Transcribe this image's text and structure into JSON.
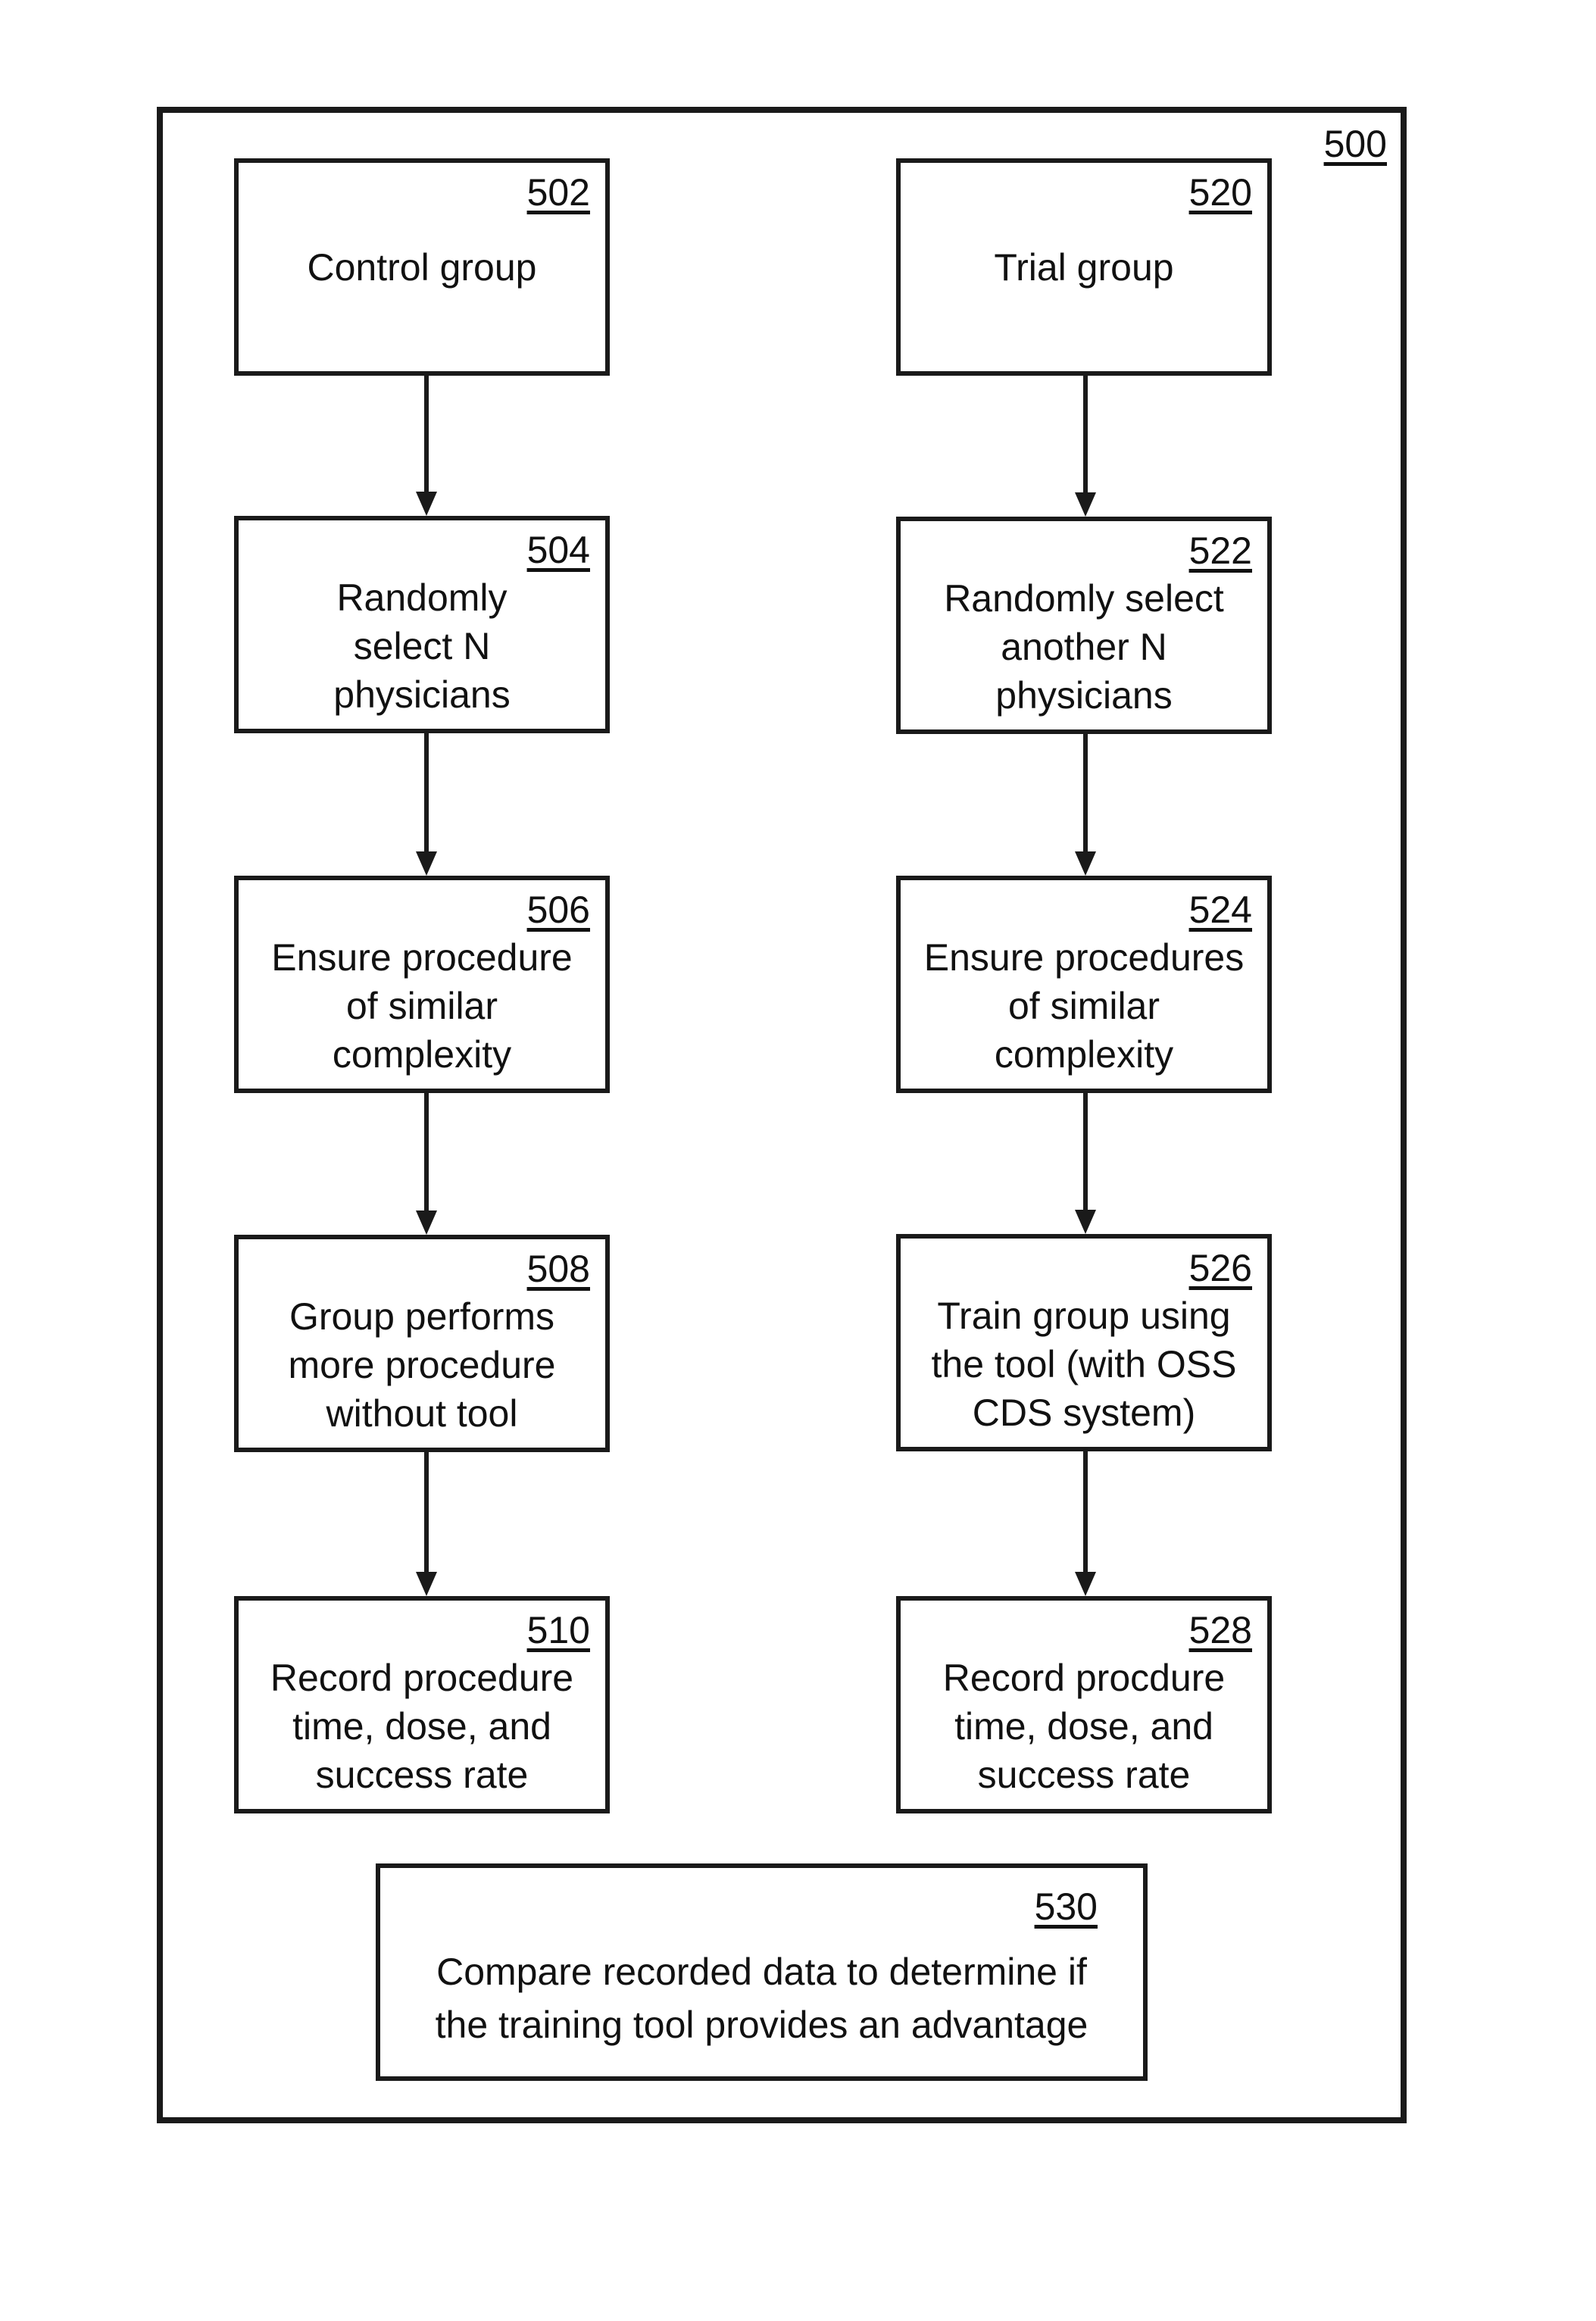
{
  "figure": {
    "ref": "500"
  },
  "control_column": [
    {
      "ref": "502",
      "text": "Control group"
    },
    {
      "ref": "504",
      "text": "Randomly\nselect N\nphysicians"
    },
    {
      "ref": "506",
      "text": "Ensure procedure\nof similar\ncomplexity"
    },
    {
      "ref": "508",
      "text": "Group performs\nmore procedure\nwithout tool"
    },
    {
      "ref": "510",
      "text": "Record procedure\ntime, dose, and\nsuccess rate"
    }
  ],
  "trial_column": [
    {
      "ref": "520",
      "text": "Trial group"
    },
    {
      "ref": "522",
      "text": "Randomly select\nanother N\nphysicians"
    },
    {
      "ref": "524",
      "text": "Ensure procedures\nof similar\ncomplexity"
    },
    {
      "ref": "526",
      "text": "Train group using\nthe tool (with OSS\nCDS system)"
    },
    {
      "ref": "528",
      "text": "Record procdure\ntime, dose, and\nsuccess rate"
    }
  ],
  "comparison": {
    "ref": "530",
    "text": "Compare recorded data to determine if\nthe training tool provides an advantage"
  }
}
